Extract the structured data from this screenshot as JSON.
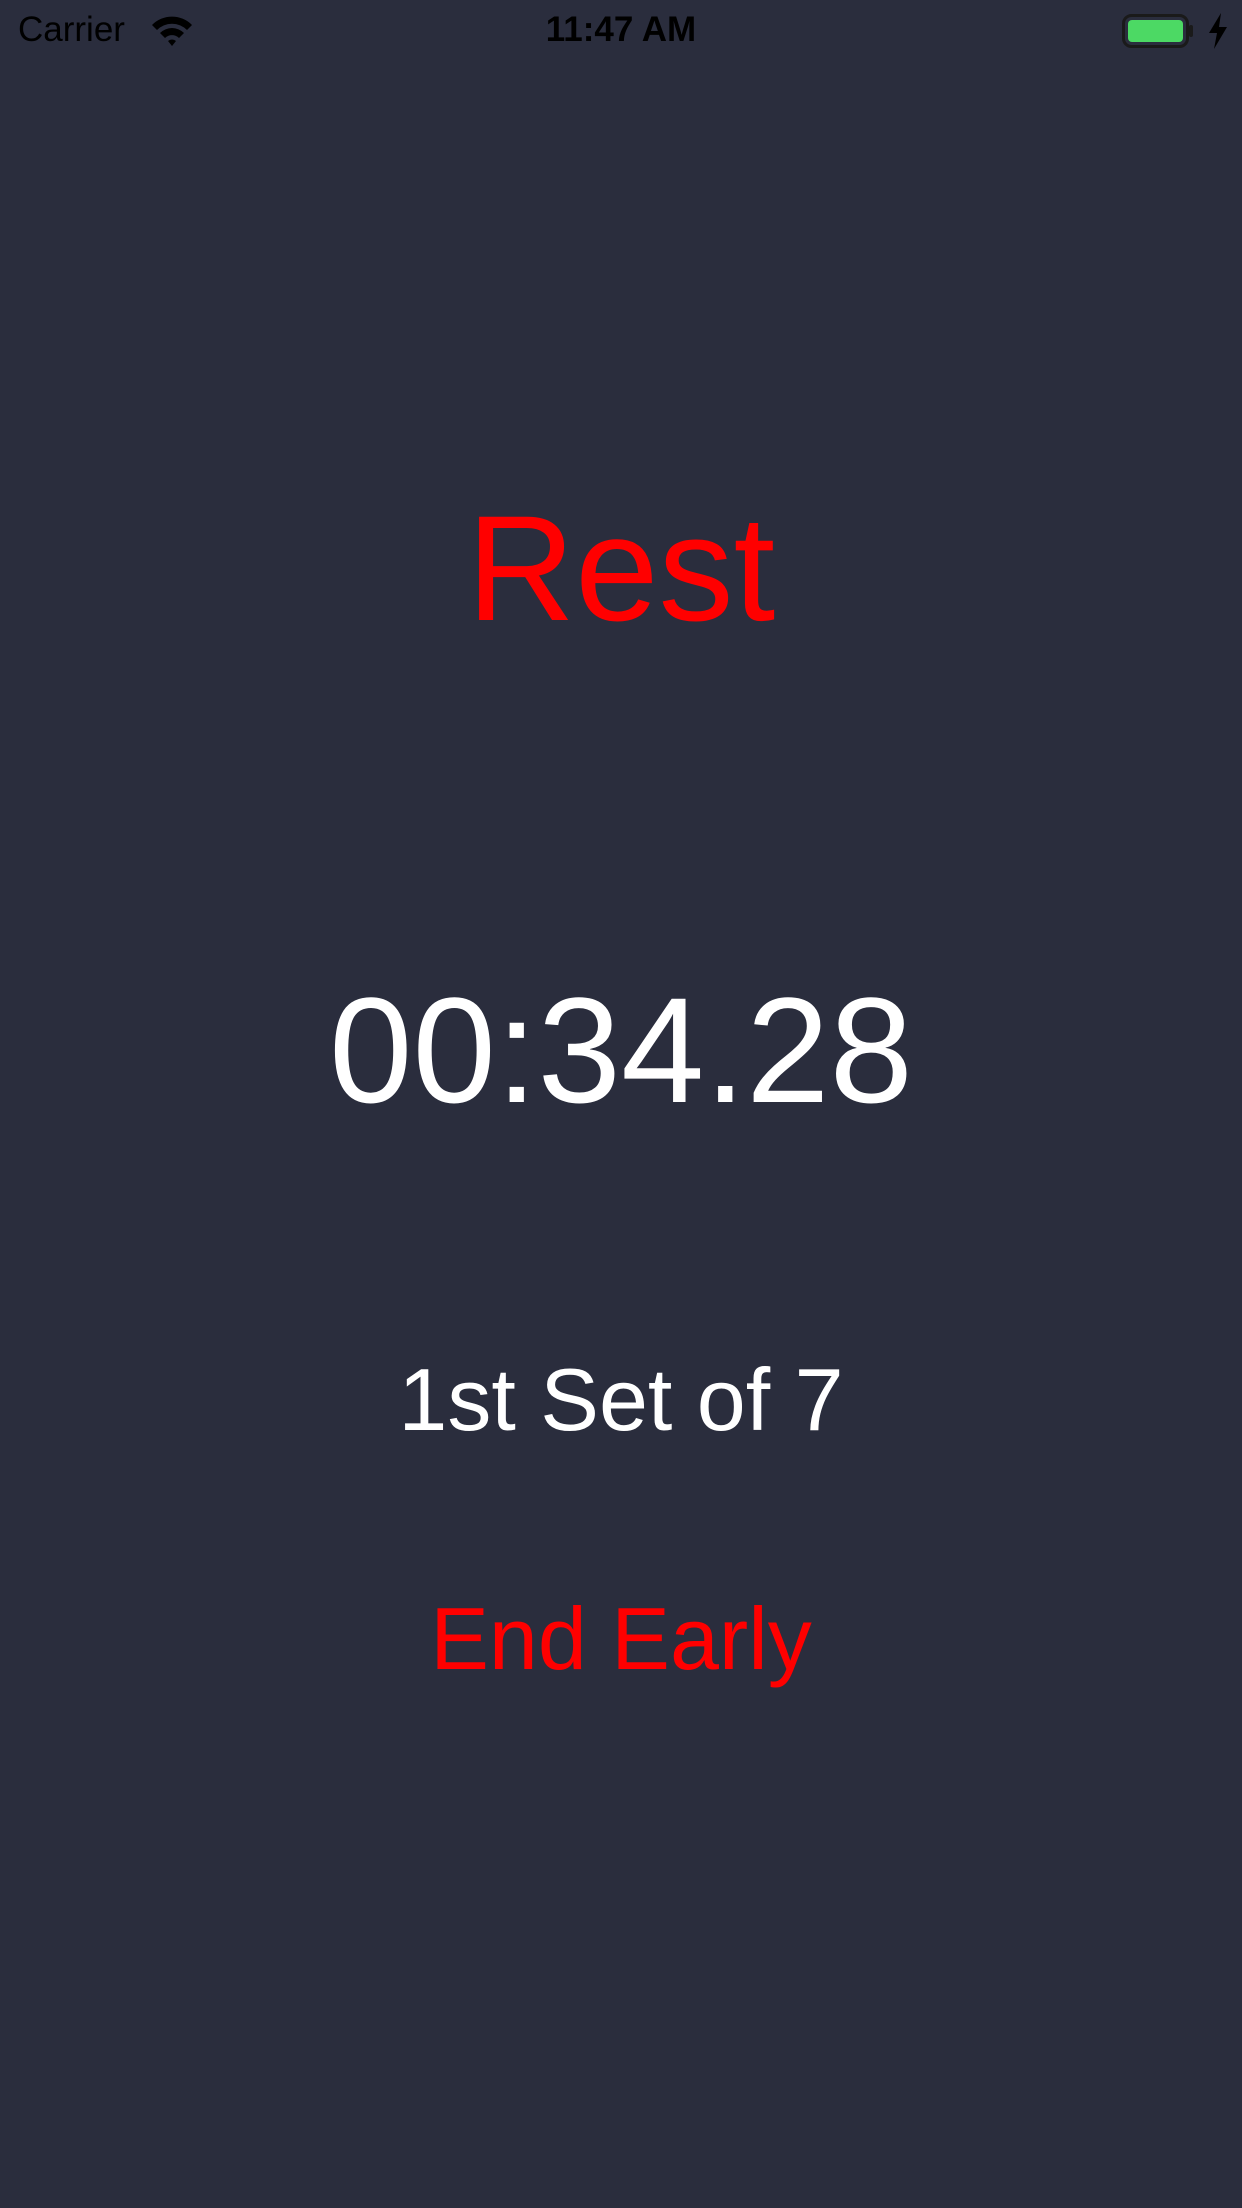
{
  "status_bar": {
    "carrier": "Carrier",
    "time": "11:47 AM",
    "battery_color": "#4cd964",
    "icons": [
      "wifi-icon",
      "battery-icon",
      "charging-bolt-icon"
    ]
  },
  "workout": {
    "phase": "Rest",
    "timer": "00:34.28",
    "set_info": "1st Set of 7",
    "end_button_label": "End Early"
  },
  "colors": {
    "background": "#2a2d3d",
    "accent": "#ff0000",
    "text": "#ffffff"
  }
}
